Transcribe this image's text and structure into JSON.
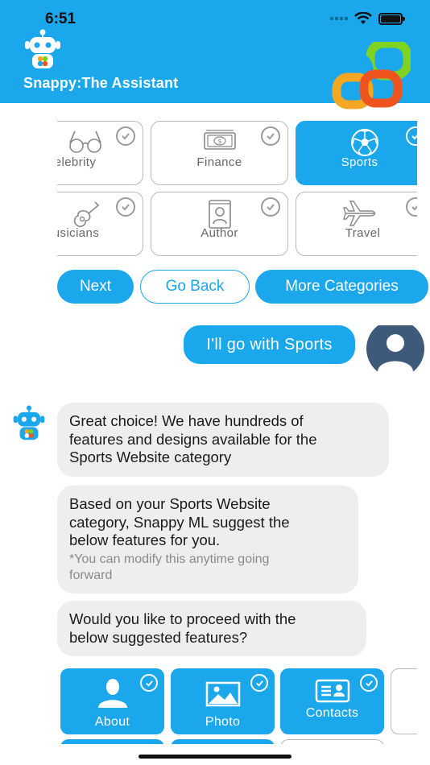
{
  "status_bar": {
    "time": "6:51"
  },
  "header": {
    "title": "Snappy:The Assistant"
  },
  "colors": {
    "accent": "#1aa7ec",
    "bubble_gray": "#eeeeee",
    "border_gray": "#b8b8b8"
  },
  "categories": {
    "row1": [
      {
        "label": "elebrity",
        "icon": "glasses-icon",
        "selected": false
      },
      {
        "label": "Finance",
        "icon": "money-icon",
        "selected": false
      },
      {
        "label": "Sports",
        "icon": "soccer-ball-icon",
        "selected": true
      }
    ],
    "row2": [
      {
        "label": "usicians",
        "icon": "guitar-icon",
        "selected": false
      },
      {
        "label": "Author",
        "icon": "book-icon",
        "selected": false
      },
      {
        "label": "Travel",
        "icon": "airplane-icon",
        "selected": false
      }
    ]
  },
  "actions": {
    "next": "Next",
    "go_back": "Go Back",
    "more": "More Categories"
  },
  "user_message": "I'll go with Sports",
  "bot_messages": {
    "m1": {
      "lines": [
        "Great choice! We have hundreds of",
        "features and designs available for the",
        "Sports Website category"
      ]
    },
    "m2": {
      "lines": [
        "Based on your Sports Website",
        "category, Snappy ML suggest the",
        "below features for you."
      ],
      "note_lines": [
        "*You can modify this anytime going",
        "forward"
      ]
    },
    "m3": {
      "lines": [
        "Would you like to proceed with the",
        "below suggested features?"
      ]
    }
  },
  "features": [
    {
      "label": "About",
      "icon": "person-icon",
      "selected": true
    },
    {
      "label": "Photo",
      "icon": "photo-icon",
      "selected": true
    },
    {
      "label": "Contacts",
      "icon": "contact-card-icon",
      "selected": true
    }
  ]
}
